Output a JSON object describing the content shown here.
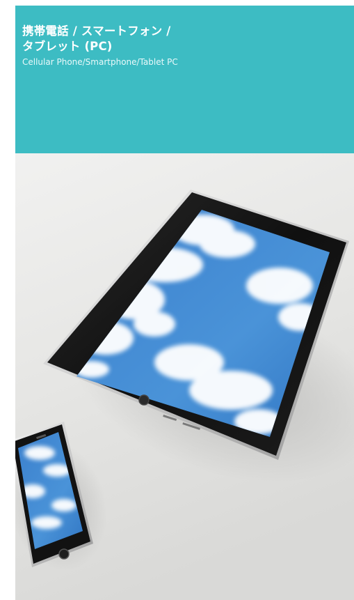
{
  "header": {
    "title_jp_line1": "携帯電話 / スマートフォン /",
    "title_jp_line2": "タブレット (PC)",
    "title_en": "Cellular Phone/Smartphone/Tablet PC"
  },
  "colors": {
    "panel": "#3dbcc3",
    "panel_text": "#ffffff",
    "sky": "#3f86cf",
    "device_frame": "#141414"
  },
  "photo": {
    "subjects": [
      "tablet",
      "smartphone"
    ]
  }
}
